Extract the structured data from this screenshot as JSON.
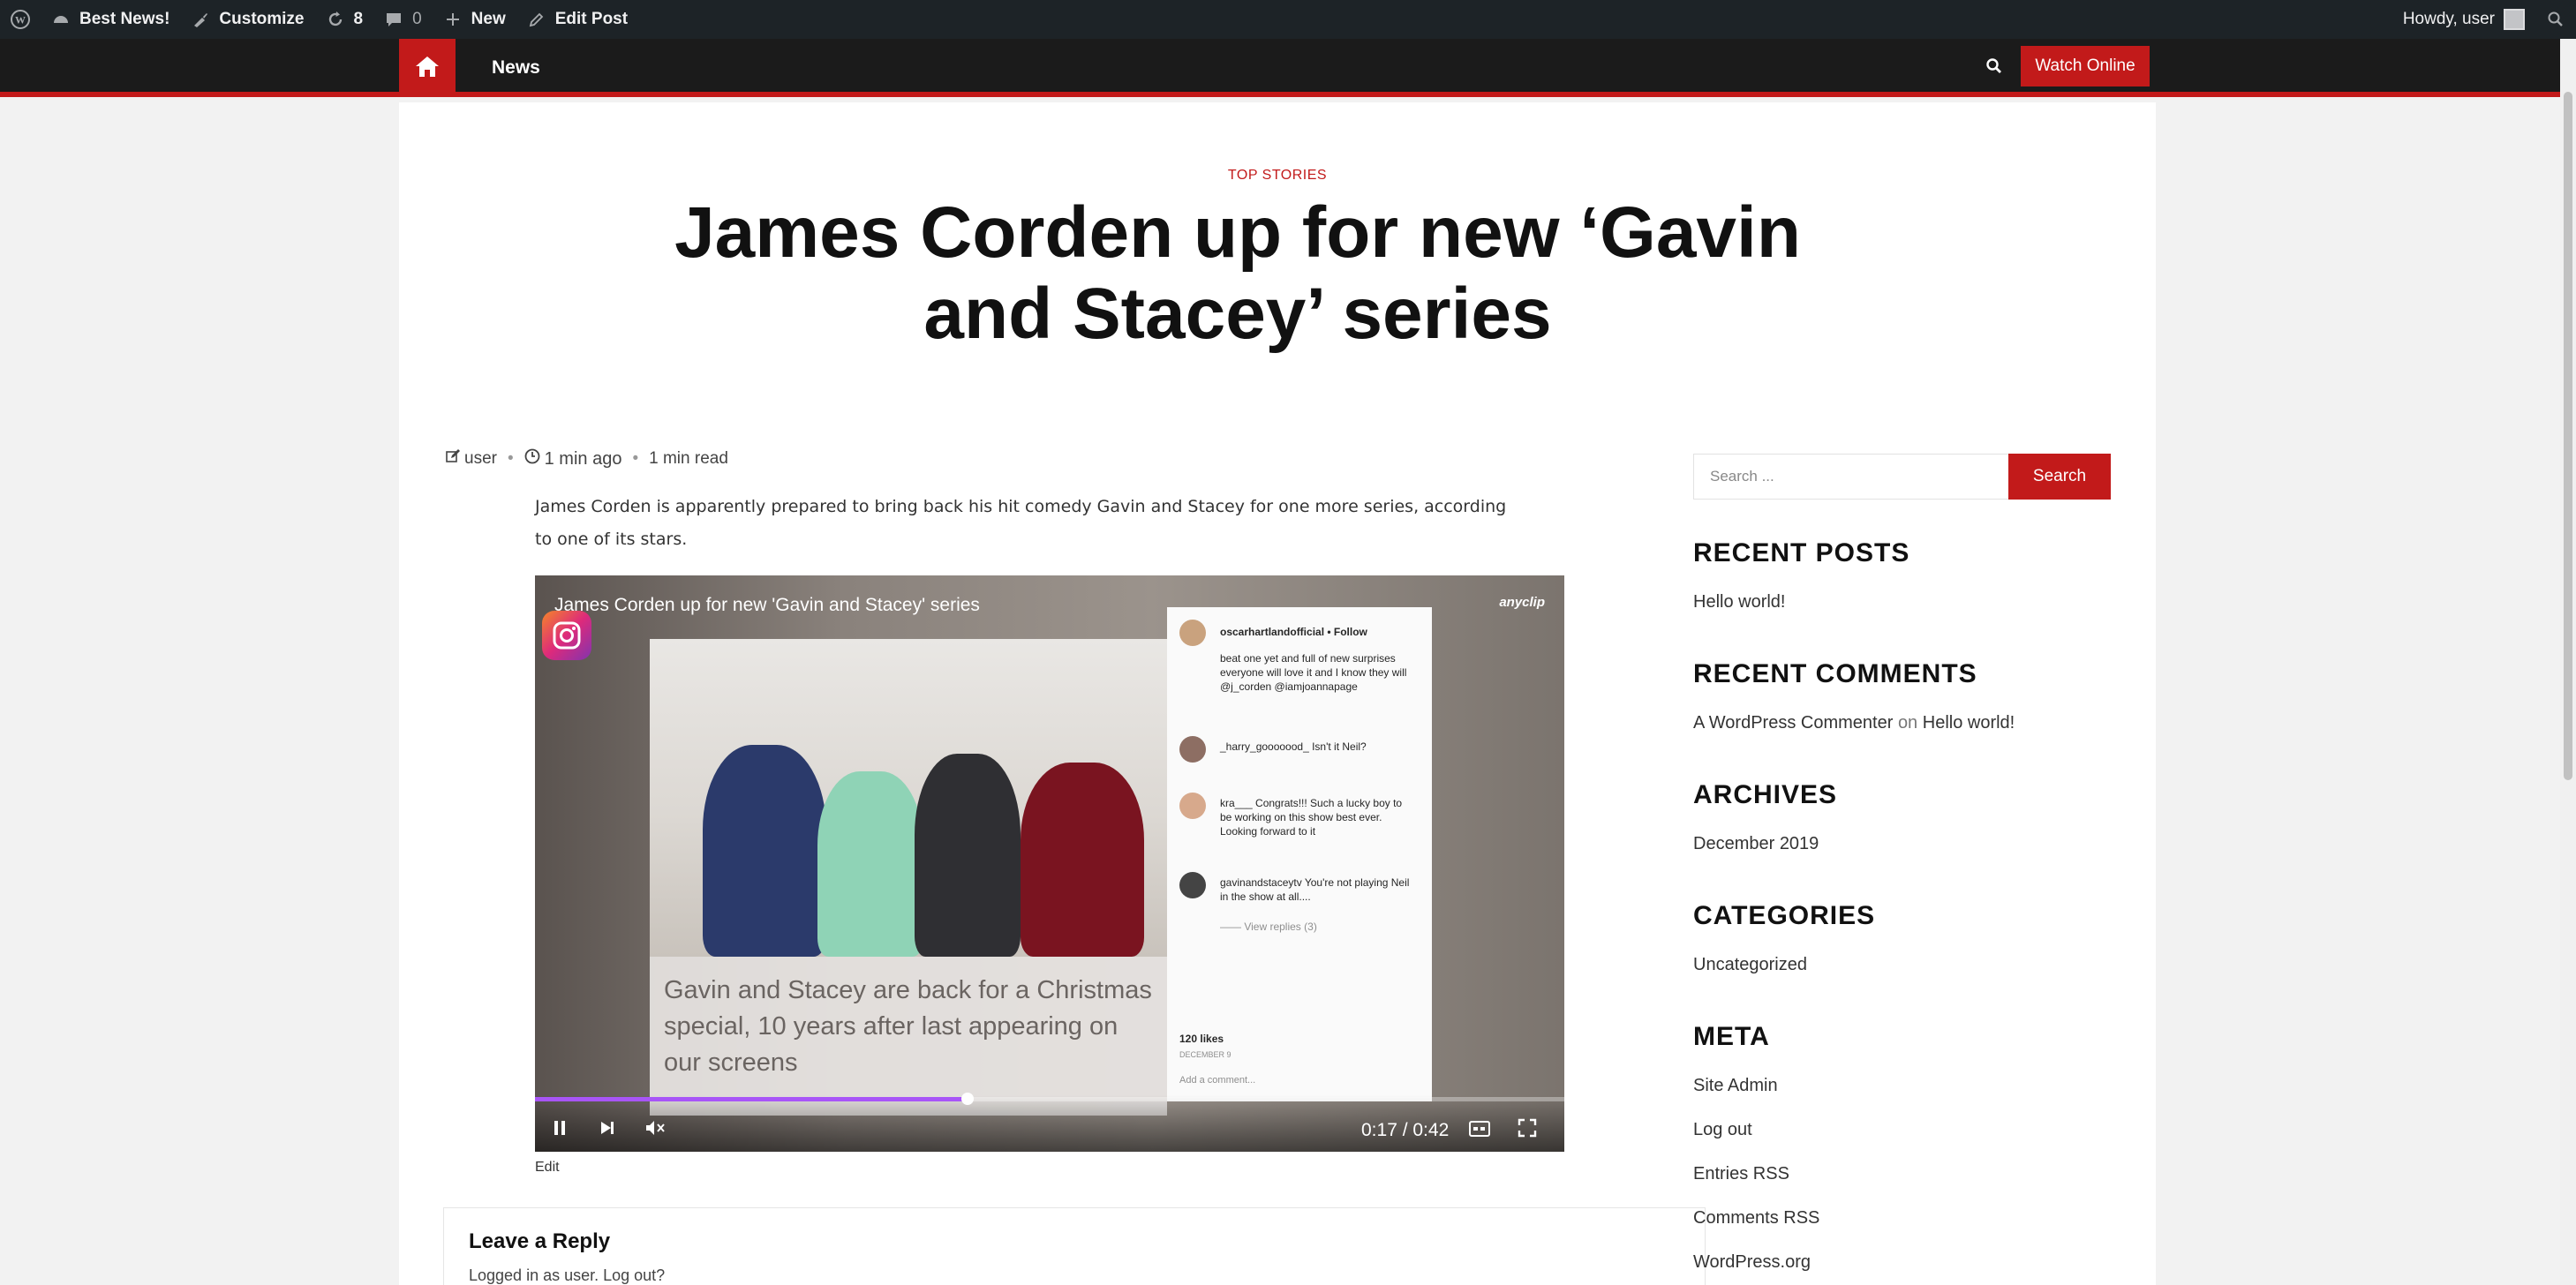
{
  "admin_bar": {
    "site_name": "Best News!",
    "customize": "Customize",
    "updates_count": "8",
    "comments_count": "0",
    "new": "New",
    "edit_post": "Edit Post",
    "howdy": "Howdy, user"
  },
  "nav": {
    "news": "News",
    "watch_online": "Watch Online"
  },
  "article": {
    "category": "TOP STORIES",
    "title": "James Corden up for new ‘Gavin and Stacey’ series",
    "author": "user",
    "time_ago": "1 min ago",
    "read_time": "1 min read",
    "excerpt": "James Corden is apparently prepared to bring back his hit comedy Gavin and Stacey for one more series, according to one of its stars.",
    "edit": "Edit"
  },
  "video": {
    "title": "James Corden up for new 'Gavin and Stacey' series",
    "brand": "anyclip",
    "caption": "Gavin and Stacey are back for a Christmas special, 10 years after last appearing on our screens",
    "time": "0:17 / 0:42",
    "progress": 0.42,
    "ig": {
      "account": "oscarhartlandofficial • Follow",
      "post_text": "beat one yet and full of new surprises everyone will love it and I know they will @j_corden @iamjoannapage",
      "c1": "_harry_gooooood_ Isn't it Neil?",
      "c2": "kra___ Congrats!!! Such a lucky boy to be working on this show best ever. Looking forward to it",
      "c3": "gavinandstaceytv You're not playing Neil in the show at all....",
      "view_replies": "—— View replies (3)",
      "likes": "120 likes",
      "date": "DECEMBER 9",
      "add_comment": "Add a comment..."
    }
  },
  "reply": {
    "title": "Leave a Reply",
    "logged_in": "Logged in as user. Log out?"
  },
  "sidebar": {
    "search_placeholder": "Search ...",
    "search_button": "Search",
    "recent_posts_title": "RECENT POSTS",
    "recent_post_1": "Hello world!",
    "recent_comments_title": "RECENT COMMENTS",
    "commenter": "A WordPress Commenter",
    "on": "on",
    "comment_post": "Hello world!",
    "archives_title": "ARCHIVES",
    "archive_1": "December 2019",
    "categories_title": "CATEGORIES",
    "category_1": "Uncategorized",
    "meta_title": "META",
    "meta_1": "Site Admin",
    "meta_2": "Log out",
    "meta_3": "Entries RSS",
    "meta_4": "Comments RSS",
    "meta_5": "WordPress.org"
  },
  "colors": {
    "accent": "#c21a1a",
    "admin_bar": "#1d2327",
    "nav": "#1b1b1b",
    "progress": "#a855f7"
  }
}
